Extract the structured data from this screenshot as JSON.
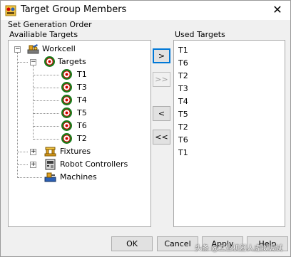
{
  "window": {
    "title": "Target Group Members",
    "close_glyph": "✕"
  },
  "group_label": "Set Generation Order",
  "available": {
    "label": "Availiable Targets",
    "root": "Workcell",
    "targets_node": "Targets",
    "targets": [
      "T1",
      "T3",
      "T4",
      "T5",
      "T6",
      "T2"
    ],
    "fixtures": "Fixtures",
    "robot_controllers": "Robot Controllers",
    "machines": "Machines",
    "expand_glyph": "+",
    "collapse_glyph": "−"
  },
  "used": {
    "label": "Used Targets",
    "items": [
      "T1",
      "T6",
      "T2",
      "T3",
      "T4",
      "T5",
      "T2",
      "T6",
      "T1"
    ]
  },
  "move_buttons": {
    "add": ">",
    "add_all": ">>",
    "remove": "<",
    "remove_all": "<<"
  },
  "dialog_buttons": {
    "ok": "OK",
    "cancel": "Cancel",
    "apply": "Apply",
    "help": "Help"
  },
  "watermark": "头条 @工业机器人虚拟调试",
  "colors": {
    "accent": "#0078d7",
    "target_red": "#d40000",
    "target_green": "#1b7a1b"
  }
}
